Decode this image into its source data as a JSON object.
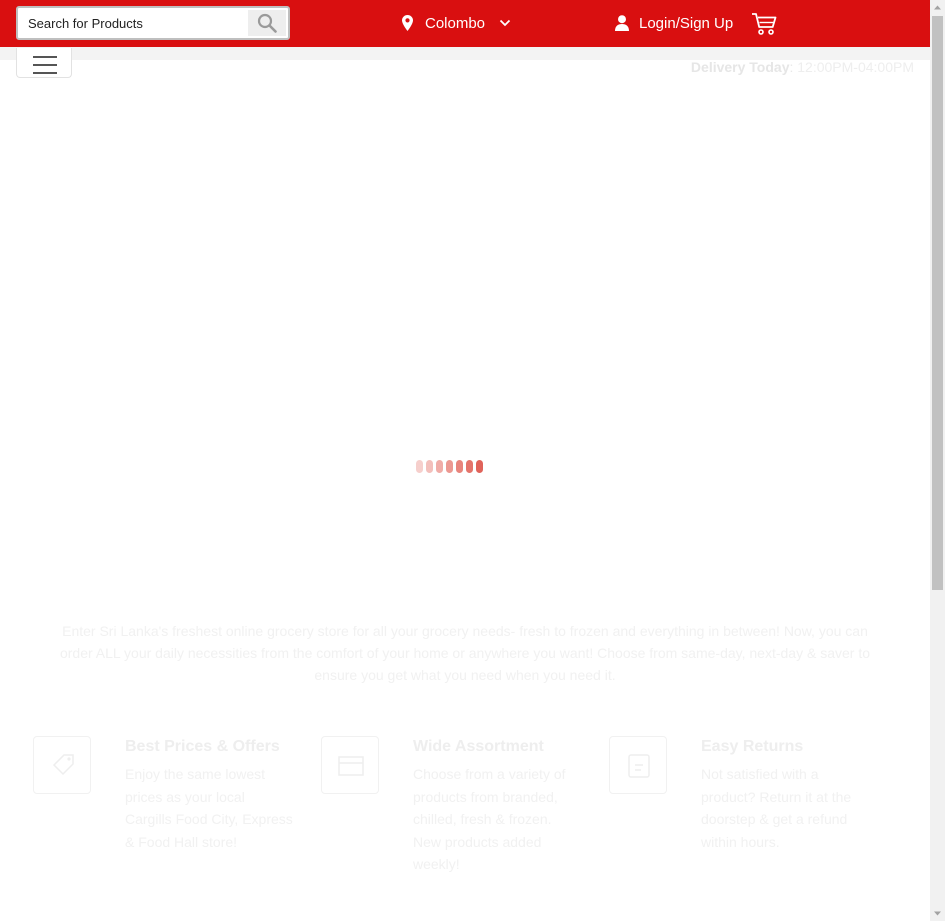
{
  "header": {
    "search": {
      "placeholder": "Search for Products",
      "value": ""
    },
    "location": "Colombo",
    "login_label": "Login/Sign Up"
  },
  "delivery": {
    "label": "Delivery Today",
    "separator": ":",
    "time": "12:00PM-04:00PM"
  },
  "loader": {
    "dot_colors": [
      "#f6cfcc",
      "#f3bfbb",
      "#f0aca7",
      "#ec9891",
      "#e8847c",
      "#e4746b",
      "#e0635a"
    ]
  },
  "intro": "Enter Sri Lanka's freshest online grocery store for all your grocery needs- fresh to frozen and everything in between! Now, you can order ALL your daily necessities from the comfort of your home or anywhere you want! Choose from same-day, next-day & saver to ensure you get what you need when you need it.",
  "features": [
    {
      "title": "Best Prices & Offers",
      "desc": "Enjoy the same lowest prices as your local Cargills Food City, Express & Food Hall store!",
      "icon": "tag-icon"
    },
    {
      "title": "Wide Assortment",
      "desc": "Choose from a variety of products from branded, chilled, fresh & frozen. New products added weekly!",
      "icon": "box-icon"
    },
    {
      "title": "Easy Returns",
      "desc": "Not satisfied with a product? Return it at the doorstep & get a refund within hours.",
      "icon": "return-icon"
    }
  ],
  "colors": {
    "brand_red": "#d90f10"
  }
}
